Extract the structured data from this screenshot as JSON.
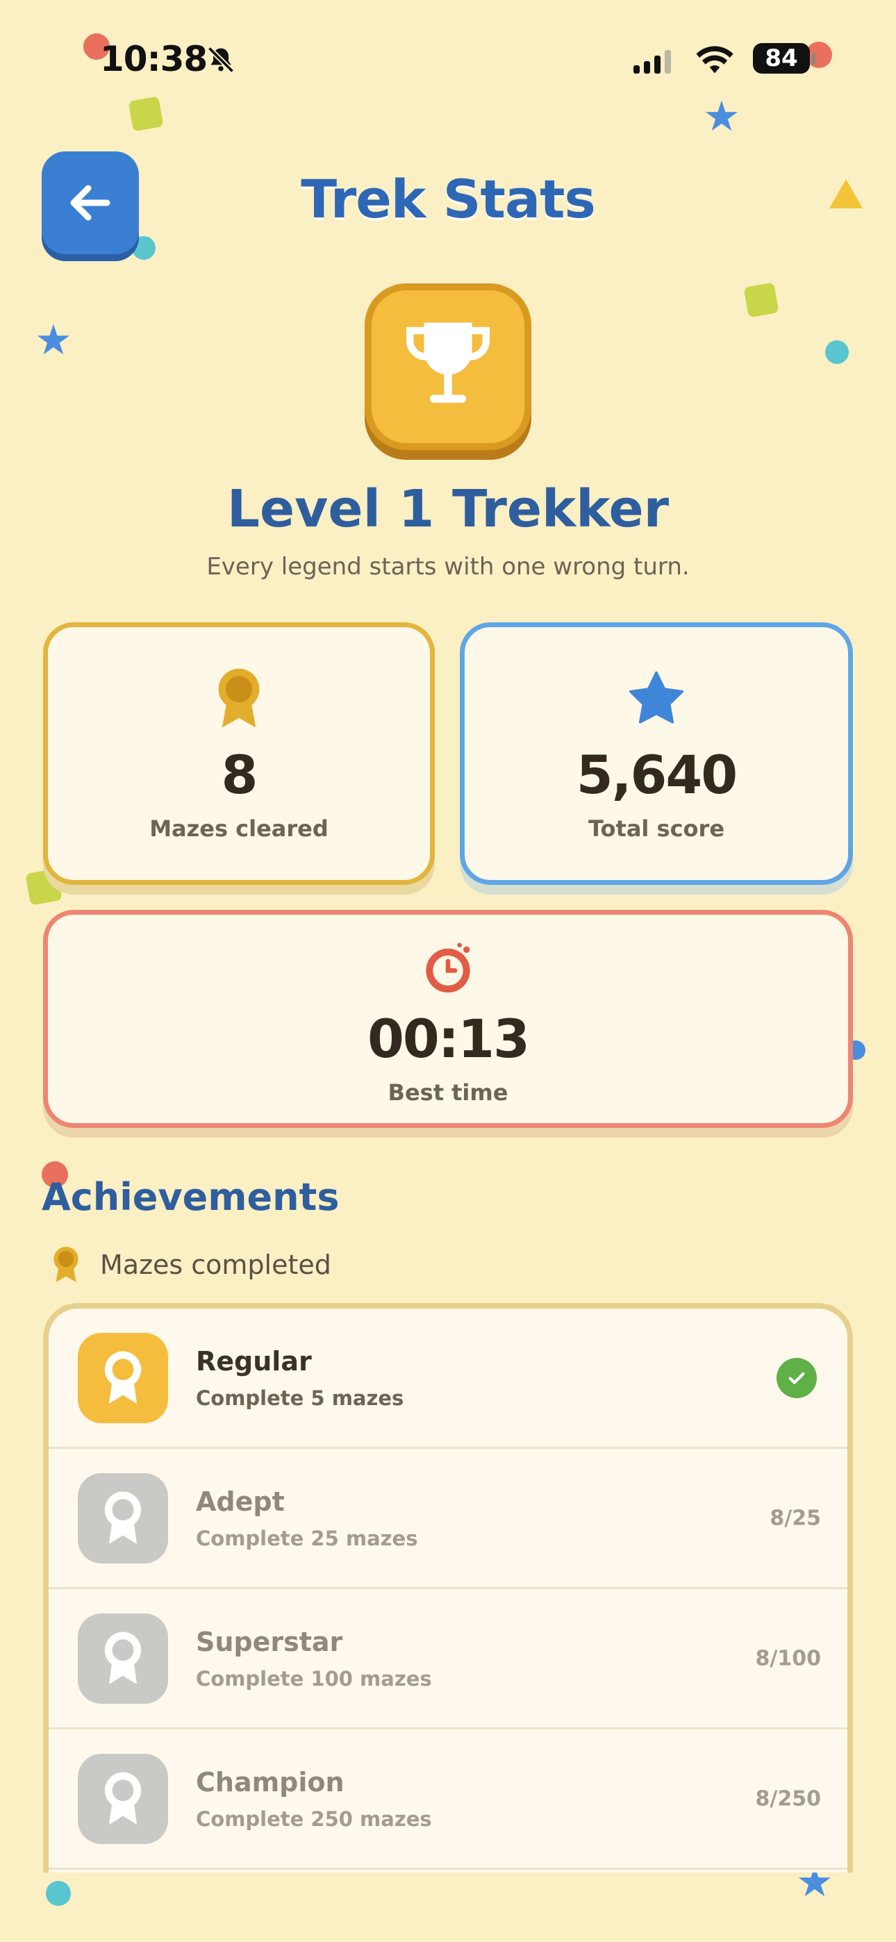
{
  "status_bar": {
    "time": "10:38",
    "battery": "84"
  },
  "header": {
    "title": "Trek Stats"
  },
  "profile": {
    "level_title": "Level 1 Trekker",
    "tagline": "Every legend starts with one wrong turn."
  },
  "stats": [
    {
      "value": "8",
      "label": "Mazes cleared",
      "icon": "ribbon-medal-icon"
    },
    {
      "value": "5,640",
      "label": "Total score",
      "icon": "star-icon"
    },
    {
      "value": "00:13",
      "label": "Best time",
      "icon": "stopwatch-icon"
    }
  ],
  "achievements": {
    "title": "Achievements",
    "group_label": "Mazes completed",
    "items": [
      {
        "name": "Regular",
        "desc": "Complete 5 mazes",
        "progress": "",
        "completed": true
      },
      {
        "name": "Adept",
        "desc": "Complete 25 mazes",
        "progress": "8/25",
        "completed": false
      },
      {
        "name": "Superstar",
        "desc": "Complete 100 mazes",
        "progress": "8/100",
        "completed": false
      },
      {
        "name": "Champion",
        "desc": "Complete 250 mazes",
        "progress": "8/250",
        "completed": false
      }
    ]
  },
  "colors": {
    "background": "#fbefc4",
    "title_blue": "#2e67b5",
    "gold": "#f5bd3e",
    "card_gold_border": "#e3b53d",
    "card_blue_border": "#5fa6e6",
    "card_red_border": "#ec8672",
    "check_green": "#5fb046"
  }
}
